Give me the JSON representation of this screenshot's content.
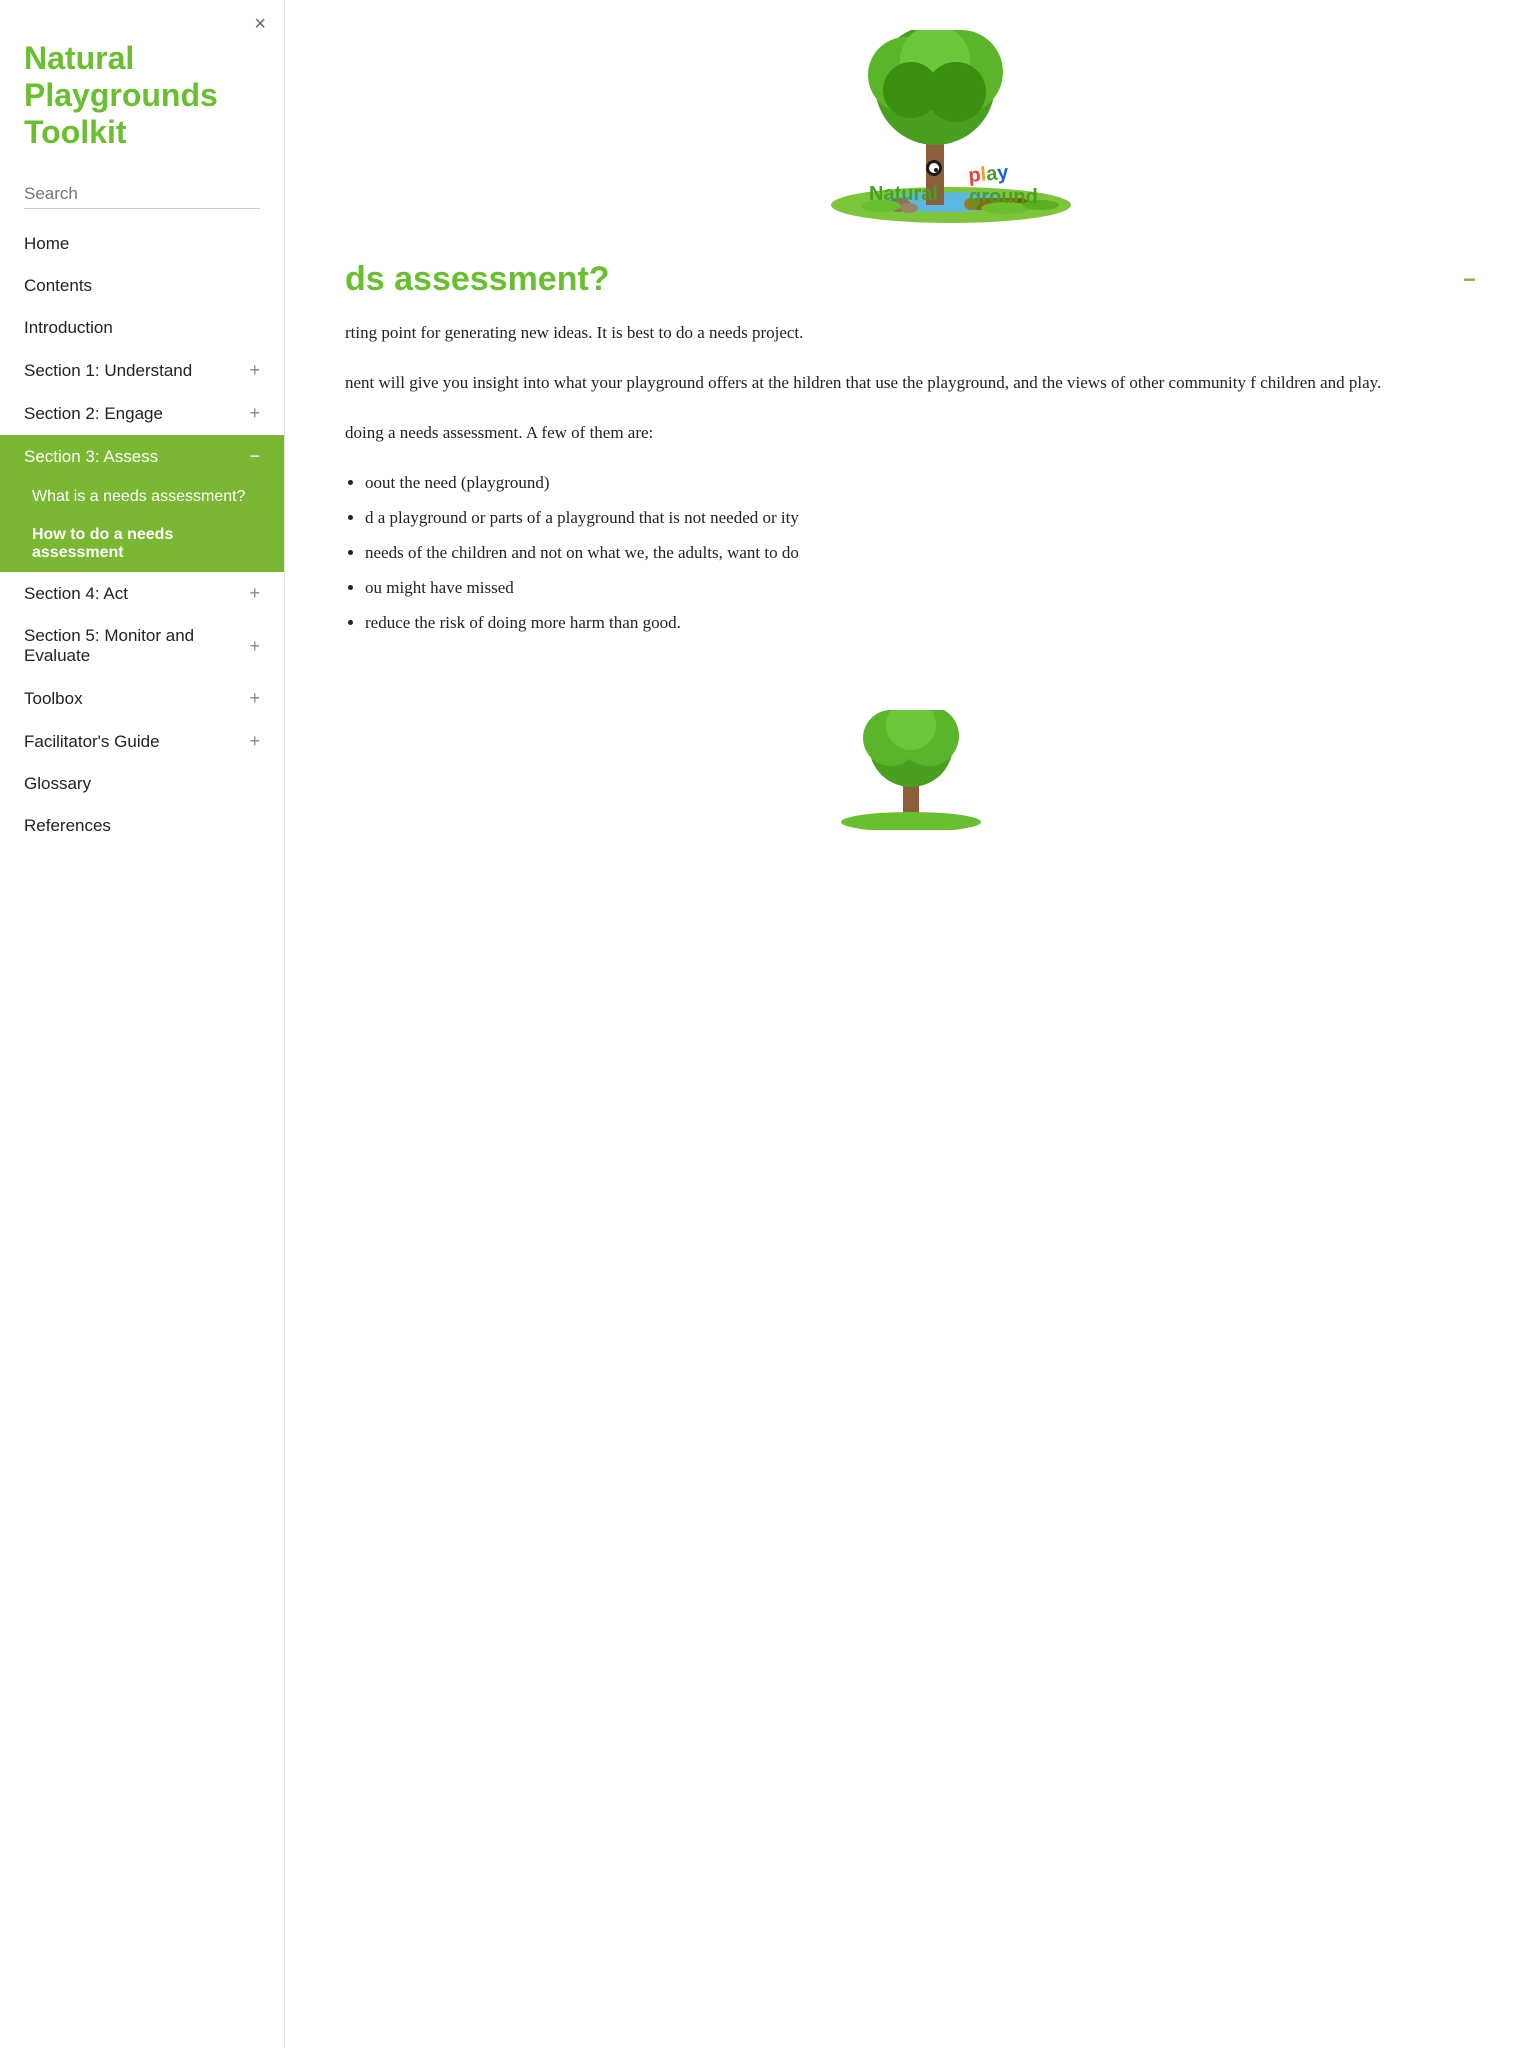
{
  "app": {
    "title": "Natural Playgrounds Toolkit",
    "close_icon": "×"
  },
  "sidebar": {
    "search_placeholder": "Search",
    "nav_items": [
      {
        "id": "home",
        "label": "Home",
        "has_children": false,
        "active": false
      },
      {
        "id": "contents",
        "label": "Contents",
        "has_children": false,
        "active": false
      },
      {
        "id": "introduction",
        "label": "Introduction",
        "has_children": false,
        "active": false
      },
      {
        "id": "section1",
        "label": "Section 1: Understand",
        "has_children": true,
        "active": false,
        "expand_icon": "+"
      },
      {
        "id": "section2",
        "label": "Section 2: Engage",
        "has_children": true,
        "active": false,
        "expand_icon": "+"
      },
      {
        "id": "section3",
        "label": "Section 3: Assess",
        "has_children": true,
        "active": true,
        "expand_icon": "−"
      },
      {
        "id": "section4",
        "label": "Section 4: Act",
        "has_children": true,
        "active": false,
        "expand_icon": "+"
      },
      {
        "id": "section5",
        "label": "Section 5: Monitor and Evaluate",
        "has_children": true,
        "active": false,
        "expand_icon": "+"
      },
      {
        "id": "toolbox",
        "label": "Toolbox",
        "has_children": true,
        "active": false,
        "expand_icon": "+"
      },
      {
        "id": "facilitators",
        "label": "Facilitator's Guide",
        "has_children": true,
        "active": false,
        "expand_icon": "+"
      },
      {
        "id": "glossary",
        "label": "Glossary",
        "has_children": false,
        "active": false
      },
      {
        "id": "references",
        "label": "References",
        "has_children": false,
        "active": false
      }
    ],
    "section3_children": [
      {
        "id": "what-needs",
        "label": "What is a needs assessment?",
        "current": false
      },
      {
        "id": "how-needs",
        "label": "How to do a needs assessment",
        "current": true
      }
    ]
  },
  "main": {
    "section_heading": "ds assessment?",
    "section_heading_full": "What is a needs assessment?",
    "collapse_icon": "−",
    "paragraphs": [
      "rting point for generating new ideas. It is best to do a needs project.",
      "nent will give you insight into what your playground offers at the hildren that use the playground, and the views of other community f children and play.",
      "doing a needs assessment. A few of them are:"
    ],
    "list_items": [
      "oout the need (playground)",
      "d a playground or parts of a playground that is not needed or ity",
      "needs of the children and not on what we, the adults, want to do",
      "ou might have missed",
      "reduce the risk of doing more harm than good."
    ]
  }
}
